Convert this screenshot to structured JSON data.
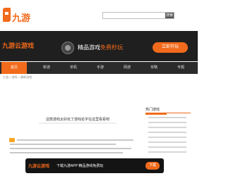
{
  "header": {
    "logo_text": "九游",
    "search_placeholder": "",
    "search_button": "搜索"
  },
  "banner": {
    "logo": "九游云游戏",
    "sub": "",
    "promo_prefix": "精品游戏",
    "promo_highlight": "免费秒玩",
    "promo_suffix": "",
    "button": "立即开玩"
  },
  "nav": {
    "items": [
      "首页",
      "新游",
      "单机",
      "手游",
      "网游",
      "攻略",
      "专题"
    ]
  },
  "breadcrumb": "九游 > 游戏 > 最新游戏",
  "article": {
    "title": "这款游戏太好玩了游戏名字在这里看看吧"
  },
  "sidebar": {
    "tab": "热门游戏"
  },
  "floatbar": {
    "logo": "九游云游戏",
    "text": "下载九游APP 精品游戏免费玩",
    "button": "下载"
  },
  "colors": {
    "accent": "#f26a1b",
    "banner_bg": "#1f1f1f",
    "nav_bg": "#2b2b2b"
  }
}
